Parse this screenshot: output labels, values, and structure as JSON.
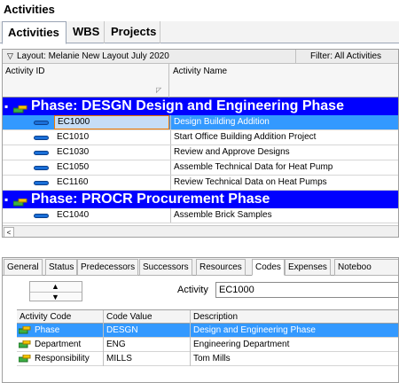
{
  "title": "Activities",
  "main_tabs": [
    "Activities",
    "WBS",
    "Projects"
  ],
  "layout_bar": {
    "layout": "Layout: Melanie New Layout July 2020",
    "filter": "Filter: All Activities"
  },
  "columns": {
    "id": "Activity ID",
    "name": "Activity Name"
  },
  "phase1": {
    "label": "Phase: DESGN  Design and Engineering Phase"
  },
  "rows1": [
    {
      "id": "EC1000",
      "name": "Design Building Addition"
    },
    {
      "id": "EC1010",
      "name": "Start Office Building Addition Project"
    },
    {
      "id": "EC1030",
      "name": "Review and Approve Designs"
    },
    {
      "id": "EC1050",
      "name": "Assemble Technical Data for Heat Pump"
    },
    {
      "id": "EC1160",
      "name": "Review Technical Data on Heat Pumps"
    }
  ],
  "phase2": {
    "label": "Phase: PROCR  Procurement Phase"
  },
  "rows2": [
    {
      "id": "EC1040",
      "name": "Assemble Brick Samples"
    }
  ],
  "detail_tabs": [
    "General",
    "Status",
    "Predecessors",
    "Successors",
    "Resources",
    "Codes",
    "Expenses",
    "Noteboo"
  ],
  "detail": {
    "activity_label": "Activity",
    "activity_value": "EC1000"
  },
  "code_headers": {
    "code": "Activity Code",
    "value": "Code Value",
    "desc": "Description"
  },
  "codes": [
    {
      "code": "Phase",
      "value": "DESGN",
      "desc": "Design and Engineering Phase"
    },
    {
      "code": "Department",
      "value": "ENG",
      "desc": "Engineering Department"
    },
    {
      "code": "Responsibility",
      "value": "MILLS",
      "desc": "Tom Mills"
    }
  ],
  "colors": {
    "phase_band": "#0000ff",
    "selection": "#3399ff"
  }
}
